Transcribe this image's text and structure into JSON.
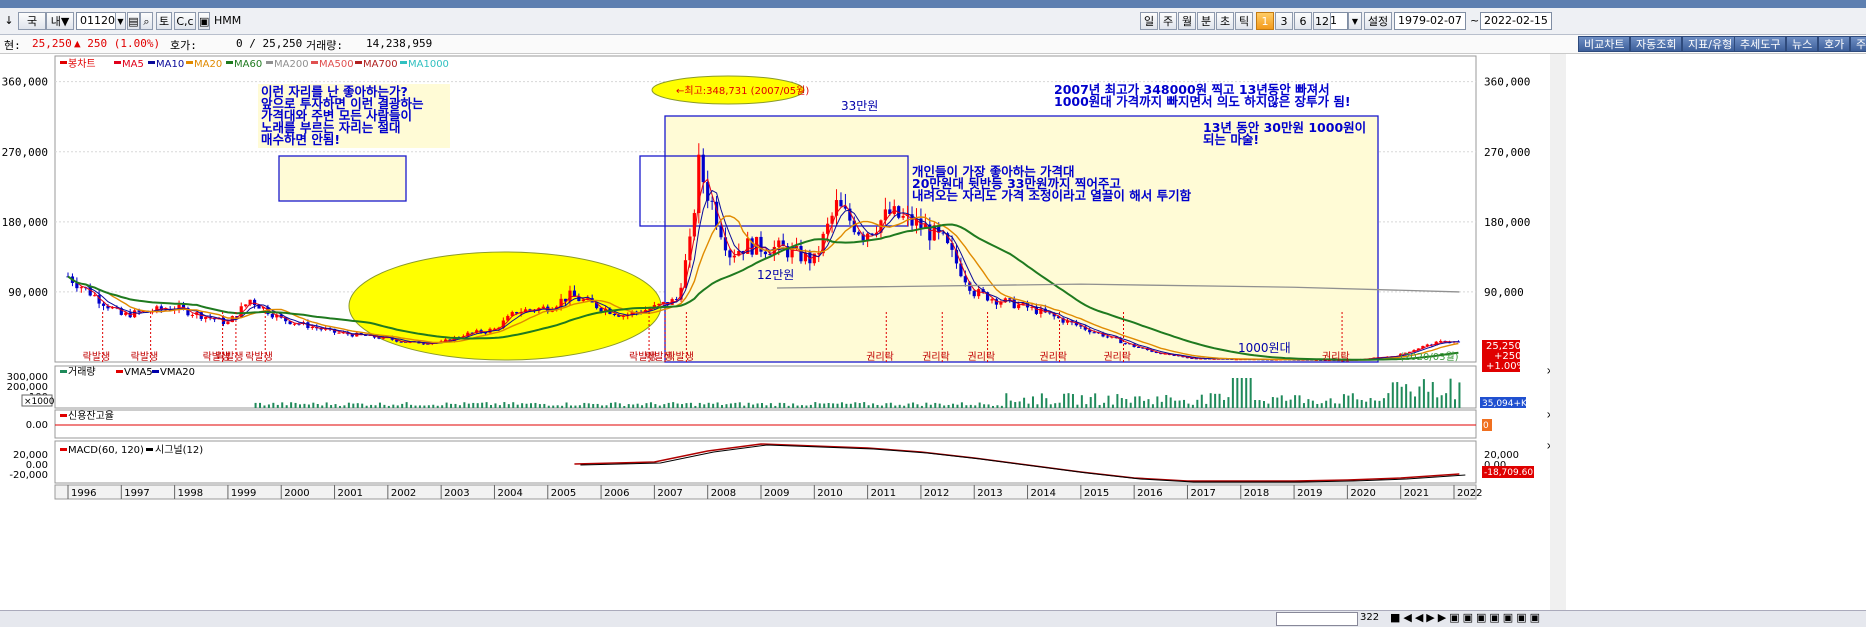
{
  "toolbar": {
    "left_icon": "↓",
    "market_tab": "국",
    "domestic_tab": "내▼",
    "stock_code": "011200",
    "btn_to": "토",
    "btn_cc": "C,c",
    "stock_name": "HMM",
    "periods": [
      "일",
      "주",
      "월",
      "분",
      "초",
      "틱"
    ],
    "numbers": [
      "1",
      "3",
      "6",
      "12"
    ],
    "count": "1",
    "settings": "설정",
    "date_from": "1979-02-07",
    "tilde": "~",
    "date_to": "2022-02-15"
  },
  "info": {
    "price_label": "현:",
    "price": "25,250",
    "change": "▲ 250 (1.00%)",
    "quote_label": "호가:",
    "quote": "0 / 25,250",
    "volume_label": "거래량:",
    "volume": "14,238,959",
    "buttons": [
      "비교차트",
      "자동조회",
      "지표/유형",
      "추세도구",
      "뉴스",
      "호가",
      "주"
    ]
  },
  "colors": {
    "candle_up": "#ff0000",
    "candle_down": "#0000cc",
    "ma5": "#e0001b",
    "ma10": "#0a0a9a",
    "ma20": "#e08a00",
    "ma60": "#1f7a1f",
    "ma200": "#909090",
    "highlight": "#ffff00",
    "note_bg": "#fffbd6",
    "note_text": "#0000cc"
  },
  "legend": [
    "봉차트",
    "MA5",
    "MA10",
    "MA20",
    "MA60",
    "MA200",
    "MA500",
    "MA700",
    "MA1000"
  ],
  "chart_data": {
    "type": "candlestick",
    "x": [
      "1996",
      "1997",
      "1998",
      "1999",
      "2000",
      "2001",
      "2002",
      "2003",
      "2004",
      "2005",
      "2006",
      "2007",
      "2008",
      "2009",
      "2010",
      "2011",
      "2012",
      "2013",
      "2014",
      "2015",
      "2016",
      "2017",
      "2018",
      "2019",
      "2020",
      "2021",
      "2022"
    ],
    "yticks": [
      "360,000",
      "270,000",
      "180,000",
      "90,000"
    ],
    "ylim": [
      0,
      375000
    ],
    "close": [
      110000,
      60000,
      70000,
      50000,
      80000,
      55000,
      38000,
      30000,
      25000,
      25000,
      35000,
      42000,
      65000,
      70000,
      85000,
      70000,
      60000,
      70000,
      80000,
      150000,
      250000,
      140000,
      150000,
      145000,
      130000,
      200000,
      165000,
      190000,
      175000,
      155000,
      90000,
      80000,
      70000,
      60000,
      45000,
      20000,
      12000,
      5000,
      3500,
      3000,
      2000,
      8000,
      20000,
      27000,
      25250
    ],
    "close_months": [
      "1996-01",
      "1997-01",
      "1998-01",
      "1999-01",
      "1999-06",
      "2000-01",
      "2001-01",
      "2002-01",
      "2002-06",
      "2003-01",
      "2003-06",
      "2004-01",
      "2004-06",
      "2005-01",
      "2005-06",
      "2006-01",
      "2006-06",
      "2007-01",
      "2007-06",
      "2007-09",
      "2007-11",
      "2008-06",
      "2008-10",
      "2009-06",
      "2010-01",
      "2010-06",
      "2010-12",
      "2011-06",
      "2012-01",
      "2012-06",
      "2013-01",
      "2013-06",
      "2014-01",
      "2014-06",
      "2015-01",
      "2016-01",
      "2016-06",
      "2017-01",
      "2018-01",
      "2019-01",
      "2020-01",
      "2020-12",
      "2021-06",
      "2021-11",
      "2022-02"
    ],
    "last_price": "25,250",
    "last_change": "+250",
    "last_pct": "+1.00%",
    "markers": [
      "락발생",
      "락발생",
      "락발생",
      "락발생",
      "락발생",
      "락발생",
      "락발생",
      "락발생",
      "권리락",
      "권리락",
      "권리락",
      "권리락",
      "권리락",
      "권리락"
    ],
    "annotations": {
      "peak": "←최고:348,731 (2007/05월)",
      "low330": "33만원",
      "low120": "12만원",
      "low1000": "1000원대",
      "low_2020": "(2020/03월)",
      "note1": [
        "이런 자리를 난 좋아하는가?",
        "앞으로 투자하면 이런 결광하는",
        "가격대와 주변 모든 사람들이",
        "노래를 부르는 자리는 절대",
        "매수하면 안됨!"
      ],
      "note2": [
        "2007년 최고가 348000원 찍고 13년동안 빠져서",
        "1000원대 가격까지 빠지면서 의도 하지않은 장투가 됨!"
      ],
      "note3": [
        "13년 동안 30만원 1000원이",
        "되는 마술!"
      ],
      "note4": [
        "개인들이 가장 좋아하는 가격대",
        "20만원대 뒷반등 33만원까지 찍어주고",
        "내려오는 자리도 가격 조정이라고 열끌이 해서 투기함"
      ]
    },
    "volume_panel": {
      "legend": [
        "거래량",
        "VMA5",
        "VMA20"
      ],
      "yticks": [
        "300,000",
        "200,000",
        "100"
      ],
      "unit": "×1000",
      "last": "35,094+K"
    },
    "credit_panel": {
      "legend": [
        "신용잔고율"
      ],
      "ytick": "0.00",
      "last": "0"
    },
    "macd_panel": {
      "legend": [
        "MACD(60, 120)",
        "시그널(12)"
      ],
      "yticks": [
        "20,000",
        "0.00",
        "-20,000"
      ],
      "right_ticks": [
        "20,000",
        "0.00"
      ],
      "last": "-18,709.60"
    }
  },
  "statusbar": {
    "page": "322"
  }
}
